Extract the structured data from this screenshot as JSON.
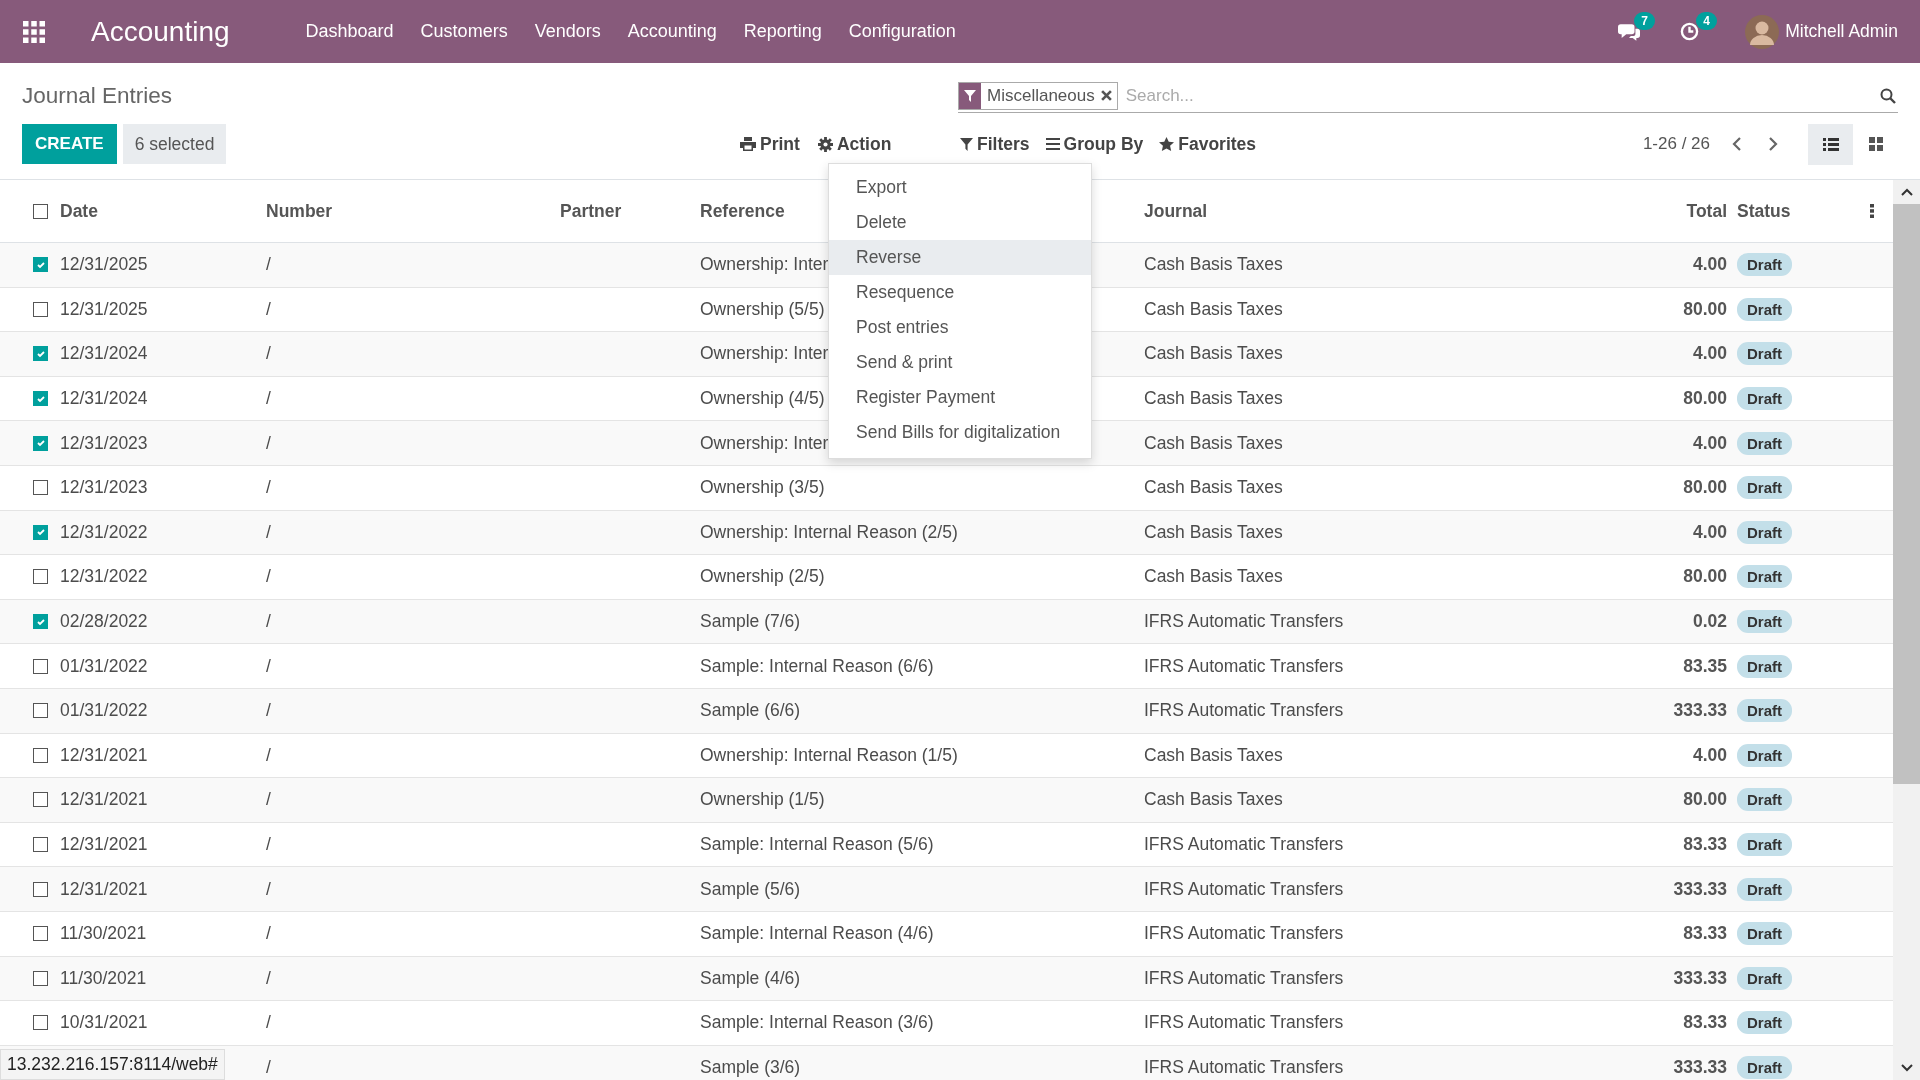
{
  "navbar": {
    "app_name": "Accounting",
    "menu": [
      "Dashboard",
      "Customers",
      "Vendors",
      "Accounting",
      "Reporting",
      "Configuration"
    ],
    "messages_count": "7",
    "activities_count": "4",
    "user": "Mitchell Admin"
  },
  "breadcrumb": "Journal Entries",
  "search": {
    "facet": "Miscellaneous",
    "placeholder": "Search..."
  },
  "create_button": "CREATE",
  "selection_count": "6 selected",
  "print_label": "Print",
  "action_label": "Action",
  "filters_label": "Filters",
  "group_by_label": "Group By",
  "favorites_label": "Favorites",
  "pager": "1-26 / 26",
  "views": [
    {
      "kind": "list",
      "selected": true
    },
    {
      "kind": "kanban",
      "selected": false
    }
  ],
  "action_menu": [
    {
      "label": "Export",
      "selected": false
    },
    {
      "label": "Delete",
      "selected": false
    },
    {
      "label": "Reverse",
      "selected": true
    },
    {
      "label": "Resequence",
      "selected": false
    },
    {
      "label": "Post entries",
      "selected": false
    },
    {
      "label": "Send & print",
      "selected": false
    },
    {
      "label": "Register Payment",
      "selected": false
    },
    {
      "label": "Send Bills for digitalization",
      "selected": false
    }
  ],
  "table": {
    "select_all_checked": false,
    "columns": [
      "Date",
      "Number",
      "Partner",
      "Reference",
      "Journal",
      "Total",
      "Status"
    ],
    "rows": [
      {
        "checked": true,
        "date": "12/31/2025",
        "number": "/",
        "reference": "Ownership: Inter",
        "journal": "Cash Basis Taxes",
        "total": "4.00",
        "status": "Draft"
      },
      {
        "checked": false,
        "date": "12/31/2025",
        "number": "/",
        "reference": "Ownership (5/5)",
        "journal": "Cash Basis Taxes",
        "total": "80.00",
        "status": "Draft"
      },
      {
        "checked": true,
        "date": "12/31/2024",
        "number": "/",
        "reference": "Ownership: Inter",
        "journal": "Cash Basis Taxes",
        "total": "4.00",
        "status": "Draft"
      },
      {
        "checked": true,
        "date": "12/31/2024",
        "number": "/",
        "reference": "Ownership (4/5)",
        "journal": "Cash Basis Taxes",
        "total": "80.00",
        "status": "Draft"
      },
      {
        "checked": true,
        "date": "12/31/2023",
        "number": "/",
        "reference": "Ownership: Inter",
        "journal": "Cash Basis Taxes",
        "total": "4.00",
        "status": "Draft"
      },
      {
        "checked": false,
        "date": "12/31/2023",
        "number": "/",
        "reference": "Ownership (3/5)",
        "journal": "Cash Basis Taxes",
        "total": "80.00",
        "status": "Draft"
      },
      {
        "checked": true,
        "date": "12/31/2022",
        "number": "/",
        "reference": "Ownership: Internal Reason (2/5)",
        "journal": "Cash Basis Taxes",
        "total": "4.00",
        "status": "Draft"
      },
      {
        "checked": false,
        "date": "12/31/2022",
        "number": "/",
        "reference": "Ownership (2/5)",
        "journal": "Cash Basis Taxes",
        "total": "80.00",
        "status": "Draft"
      },
      {
        "checked": true,
        "date": "02/28/2022",
        "number": "/",
        "reference": "Sample (7/6)",
        "journal": "IFRS Automatic Transfers",
        "total": "0.02",
        "status": "Draft"
      },
      {
        "checked": false,
        "date": "01/31/2022",
        "number": "/",
        "reference": "Sample: Internal Reason (6/6)",
        "journal": "IFRS Automatic Transfers",
        "total": "83.35",
        "status": "Draft"
      },
      {
        "checked": false,
        "date": "01/31/2022",
        "number": "/",
        "reference": "Sample (6/6)",
        "journal": "IFRS Automatic Transfers",
        "total": "333.33",
        "status": "Draft"
      },
      {
        "checked": false,
        "date": "12/31/2021",
        "number": "/",
        "reference": "Ownership: Internal Reason (1/5)",
        "journal": "Cash Basis Taxes",
        "total": "4.00",
        "status": "Draft"
      },
      {
        "checked": false,
        "date": "12/31/2021",
        "number": "/",
        "reference": "Ownership (1/5)",
        "journal": "Cash Basis Taxes",
        "total": "80.00",
        "status": "Draft"
      },
      {
        "checked": false,
        "date": "12/31/2021",
        "number": "/",
        "reference": "Sample: Internal Reason (5/6)",
        "journal": "IFRS Automatic Transfers",
        "total": "83.33",
        "status": "Draft"
      },
      {
        "checked": false,
        "date": "12/31/2021",
        "number": "/",
        "reference": "Sample (5/6)",
        "journal": "IFRS Automatic Transfers",
        "total": "333.33",
        "status": "Draft"
      },
      {
        "checked": false,
        "date": "11/30/2021",
        "number": "/",
        "reference": "Sample: Internal Reason (4/6)",
        "journal": "IFRS Automatic Transfers",
        "total": "83.33",
        "status": "Draft"
      },
      {
        "checked": false,
        "date": "11/30/2021",
        "number": "/",
        "reference": "Sample (4/6)",
        "journal": "IFRS Automatic Transfers",
        "total": "333.33",
        "status": "Draft"
      },
      {
        "checked": false,
        "date": "10/31/2021",
        "number": "/",
        "reference": "Sample: Internal Reason (3/6)",
        "journal": "IFRS Automatic Transfers",
        "total": "83.33",
        "status": "Draft"
      },
      {
        "number": "/",
        "reference": "Sample (3/6)",
        "journal": "IFRS Automatic Transfers",
        "total": "333.33",
        "status": "Draft"
      }
    ]
  },
  "status_url": "13.232.216.157:8114/web#"
}
